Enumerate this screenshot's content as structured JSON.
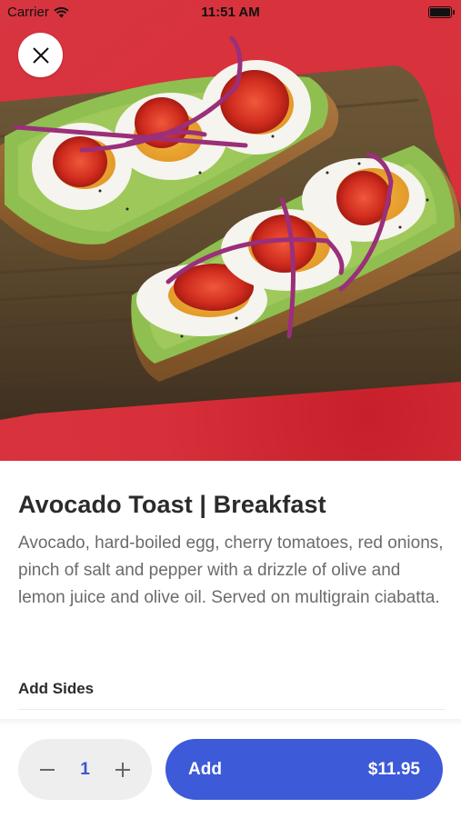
{
  "status_bar": {
    "carrier": "Carrier",
    "time": "11:51 AM"
  },
  "hero": {
    "icon": "close-icon"
  },
  "item": {
    "title": "Avocado Toast | Breakfast",
    "description": "Avocado, hard-boiled egg, cherry tomatoes, red onions, pinch of salt and pepper with a drizzle of olive and lemon juice and olive oil. Served on multigrain ciabatta."
  },
  "sides": {
    "label": "Add Sides"
  },
  "order": {
    "quantity": "1",
    "add_label": "Add",
    "price": "$11.95"
  },
  "colors": {
    "accent": "#3d5ad8",
    "quantity_text": "#3c54d4",
    "hero_background": "#d73540"
  }
}
